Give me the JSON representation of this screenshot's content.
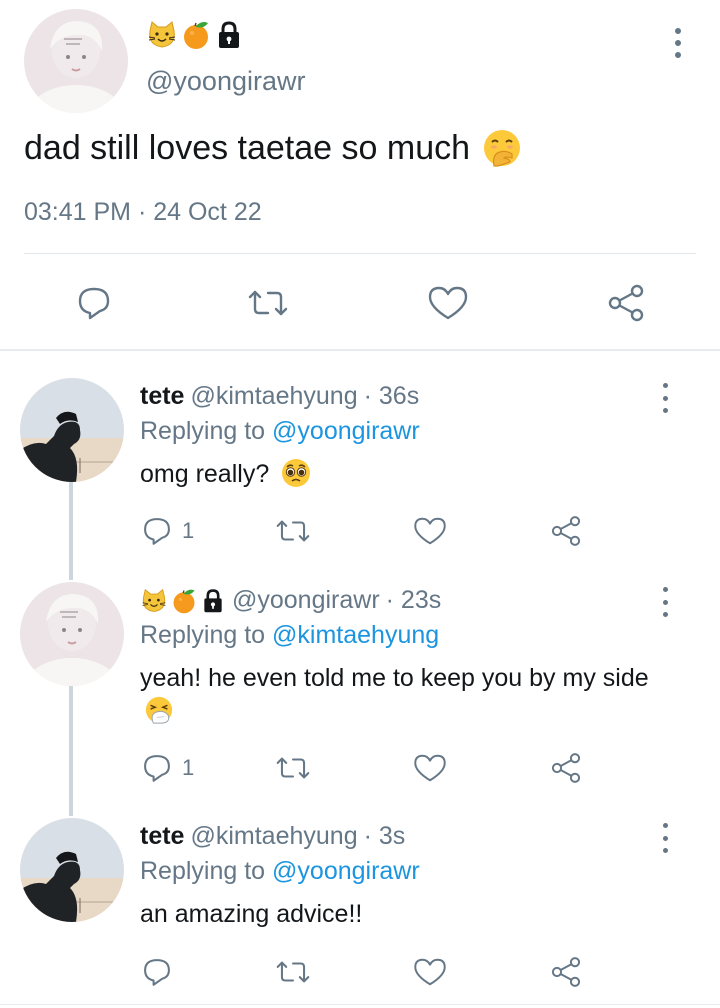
{
  "main_tweet": {
    "handle": "@yoongirawr",
    "badges": [
      "cat-face-emoji",
      "tangerine-emoji",
      "locked-padlock-icon"
    ],
    "text": "dad still loves taetae so much",
    "text_emoji": "hand-over-mouth-emoji",
    "meta": "03:41 PM · 24 Oct 22",
    "actions": [
      "reply-icon",
      "retweet-icon",
      "like-icon",
      "share-icon"
    ]
  },
  "replies": [
    {
      "name": "tete",
      "handle": "@kimtaehyung",
      "time": "· 36s",
      "replying_prefix": "Replying to",
      "replying_handle": "@yoongirawr",
      "text": "omg really?",
      "text_emoji": "pleading-face-emoji",
      "reply_count": "1"
    },
    {
      "badges": [
        "cat-face-emoji",
        "tangerine-emoji",
        "locked-padlock-icon"
      ],
      "handle": "@yoongirawr",
      "time": "· 23s",
      "replying_prefix": "Replying to",
      "replying_handle": "@kimtaehyung",
      "text": "yeah! he even told me to keep you by my side",
      "text_emoji": "sneezing-face-emoji",
      "reply_count": "1"
    },
    {
      "name": "tete",
      "handle": "@kimtaehyung",
      "time": "· 3s",
      "replying_prefix": "Replying to",
      "replying_handle": "@yoongirawr",
      "text": "an amazing advice!!",
      "reply_count": ""
    }
  ],
  "colors": {
    "text": "#14171a",
    "secondary": "#657786",
    "link": "#1b95e0",
    "divider": "#e1e8ed",
    "thread_line": "#ccd6dd"
  }
}
